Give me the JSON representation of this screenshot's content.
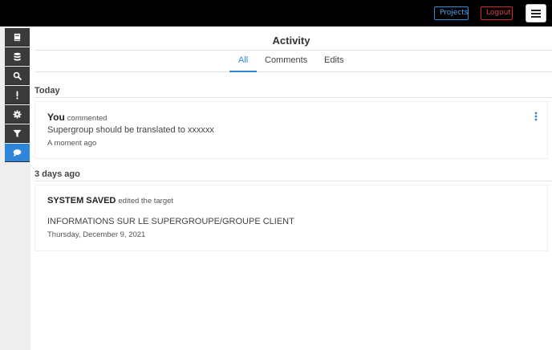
{
  "header": {
    "projects_label": "Projects",
    "logout_label": "Logout",
    "menu_icon": "hamburger-icon",
    "colors": {
      "background": "#000000",
      "projects": "#2e8bd8",
      "logout": "#d0232d"
    }
  },
  "sidebar": {
    "items": [
      {
        "icon": "book-icon",
        "active": false
      },
      {
        "icon": "database-icon",
        "active": false
      },
      {
        "icon": "search-icon",
        "active": false
      },
      {
        "icon": "exclamation-icon",
        "active": false
      },
      {
        "icon": "gear-icon",
        "active": false
      },
      {
        "icon": "filter-icon",
        "active": false
      },
      {
        "icon": "comment-icon",
        "active": true
      }
    ],
    "active_color": "#2f86d9"
  },
  "main": {
    "title": "Activity",
    "tabs": [
      {
        "label": "All",
        "selected": true
      },
      {
        "label": "Comments",
        "selected": false
      },
      {
        "label": "Edits",
        "selected": false
      }
    ],
    "groups": [
      {
        "heading": "Today",
        "entries": [
          {
            "actor": "You",
            "verb": "commented",
            "body": "Supergroup should be translated to xxxxxx",
            "time": "A moment ago"
          }
        ]
      },
      {
        "heading": "3 days ago",
        "entries": [
          {
            "actor": "SYSTEM SAVED",
            "verb": "edited the target",
            "body": "INFORMATIONS SUR LE SUPERGROUPE/GROUPE CLIENT",
            "time": "Thursday, December 9, 2021"
          }
        ]
      }
    ]
  }
}
